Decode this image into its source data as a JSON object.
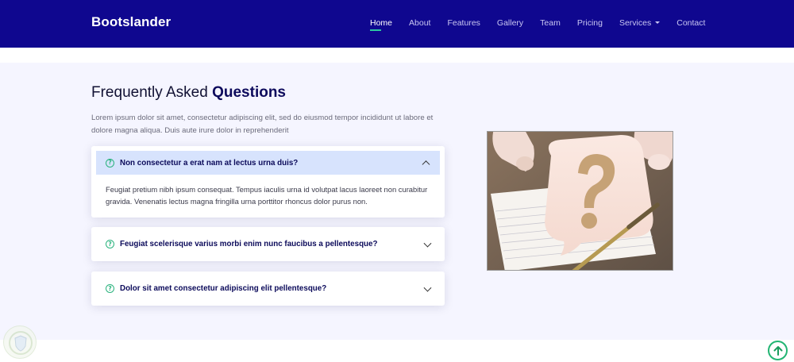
{
  "header": {
    "brand": "Bootslander",
    "nav": [
      {
        "label": "Home"
      },
      {
        "label": "About"
      },
      {
        "label": "Features"
      },
      {
        "label": "Gallery"
      },
      {
        "label": "Team"
      },
      {
        "label": "Pricing"
      },
      {
        "label": "Services"
      },
      {
        "label": "Contact"
      }
    ]
  },
  "faq": {
    "title_light": "Frequently Asked ",
    "title_bold": "Questions",
    "description": "Lorem ipsum dolor sit amet, consectetur adipiscing elit, sed do eiusmod tempor incididunt ut labore et dolore magna aliqua. Duis aute irure dolor in reprehenderit",
    "items": [
      {
        "question": "Non consectetur a erat nam at lectus urna duis?",
        "answer": "Feugiat pretium nibh ipsum consequat. Tempus iaculis urna id volutpat lacus laoreet non curabitur gravida. Venenatis lectus magna fringilla urna porttitor rhoncus dolor purus non."
      },
      {
        "question": "Feugiat scelerisque varius morbi enim nunc faucibus a pellentesque?"
      },
      {
        "question": "Dolor sit amet consectetur adipiscing elit pellentesque?"
      }
    ]
  },
  "icons": {
    "question": "question-circle-icon",
    "chevron": "chevron-icon",
    "back_to_top": "arrow-up-circle-icon",
    "dropdown": "caret-down-icon"
  },
  "colors": {
    "header_bg": "#0f078f",
    "accent_green": "#2bb37e",
    "open_item_bg": "#d7e3fd",
    "section_bg": "#f5f5ff"
  }
}
